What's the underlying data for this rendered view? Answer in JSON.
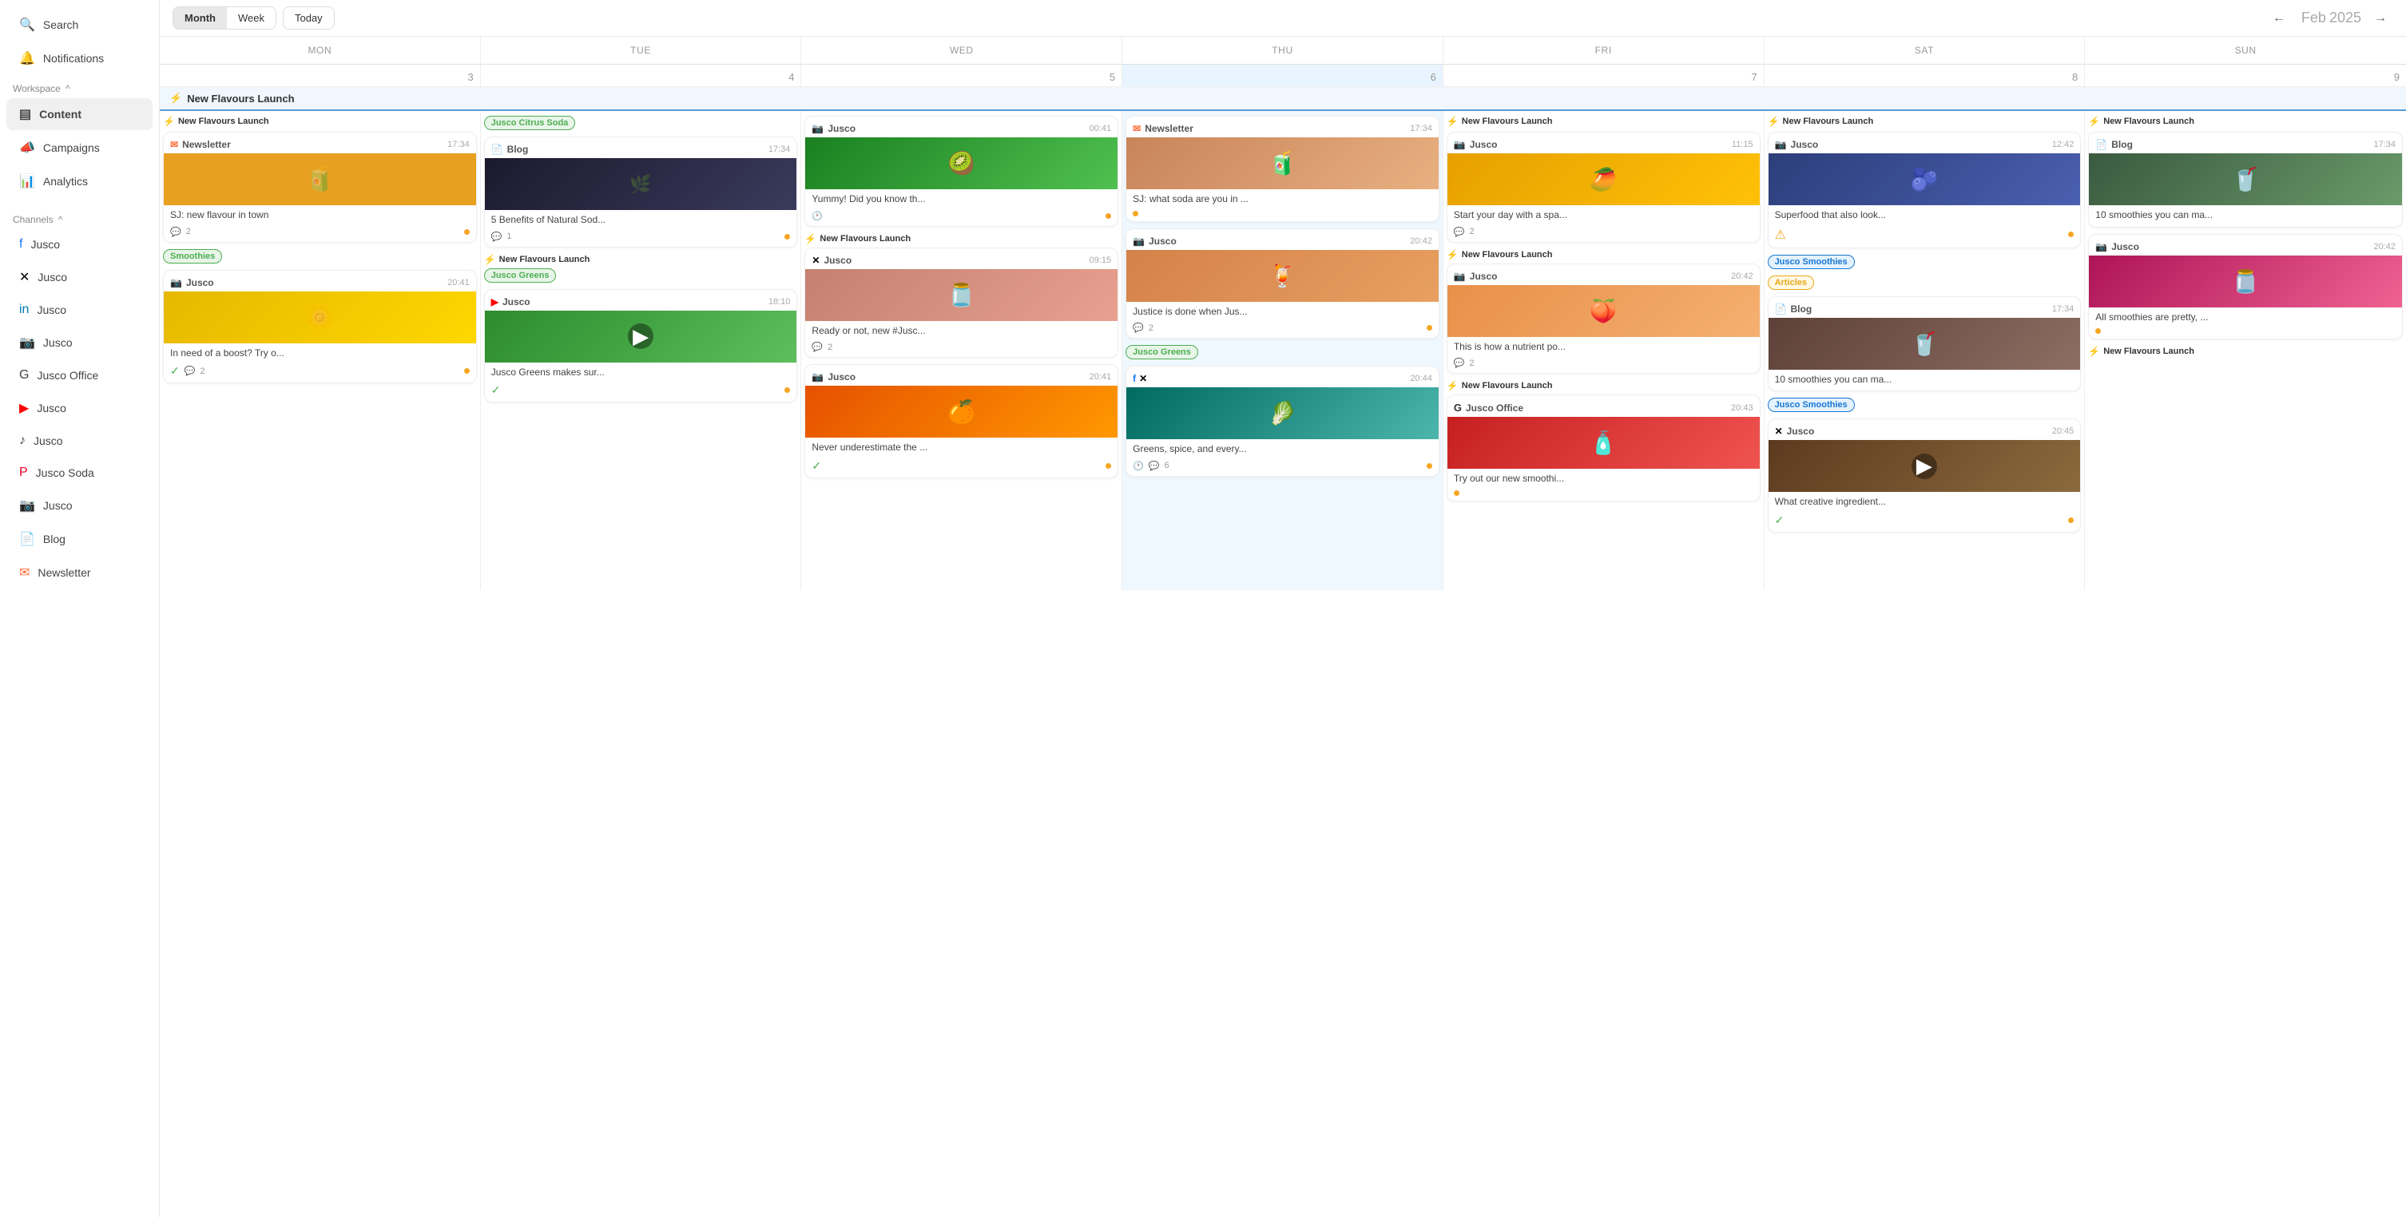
{
  "sidebar": {
    "search_label": "Search",
    "notifications_label": "Notifications",
    "workspace_label": "Workspace",
    "workspace_chevron": "^",
    "content_label": "Content",
    "campaigns_label": "Campaigns",
    "analytics_label": "Analytics",
    "channels_label": "Channels",
    "channels_chevron": "^",
    "channels": [
      {
        "label": "Jusco",
        "type": "facebook"
      },
      {
        "label": "Jusco",
        "type": "twitter"
      },
      {
        "label": "Jusco",
        "type": "linkedin"
      },
      {
        "label": "Jusco",
        "type": "instagram"
      },
      {
        "label": "Jusco Office",
        "type": "google"
      },
      {
        "label": "Jusco",
        "type": "youtube"
      },
      {
        "label": "Jusco",
        "type": "tiktok"
      },
      {
        "label": "Jusco Soda",
        "type": "pinterest"
      },
      {
        "label": "Jusco",
        "type": "instagram2"
      },
      {
        "label": "Blog",
        "type": "blog"
      },
      {
        "label": "Newsletter",
        "type": "newsletter"
      }
    ]
  },
  "topbar": {
    "month_label": "Month",
    "week_label": "Week",
    "today_label": "Today",
    "month_name": "Feb",
    "year": "2025"
  },
  "calendar": {
    "days": [
      "MON",
      "TUE",
      "WED",
      "THU",
      "FRI",
      "SAT",
      "SUN"
    ],
    "dates": [
      "3",
      "4",
      "5",
      "6",
      "7",
      "8",
      "9"
    ],
    "campaign_name": "New Flavours Launch",
    "columns": {
      "mon": {
        "date": "3",
        "campaign": "New Flavours Launch",
        "cards": [
          {
            "platform": "Newsletter",
            "time": "17:34",
            "img_type": "orange",
            "text": "SJ: new flavour in town",
            "comments": "2",
            "dot": "orange"
          }
        ],
        "cards2": [
          {
            "tag": "Smoothies",
            "tag_type": "green",
            "platform": "Instagram",
            "time": "20:41",
            "img_type": "yellow",
            "text": "In need of a boost? Try o...",
            "check": true,
            "comments": "2",
            "dot": "orange"
          }
        ]
      },
      "tue": {
        "date": "4",
        "cards": [
          {
            "tag": "Jusco Citrus Soda",
            "tag_type": "green",
            "platform": "Blog",
            "time": "17:34",
            "img_type": "dark",
            "text": "5 Benefits of Natural Sod...",
            "comments": "1",
            "dot": "orange"
          },
          {
            "campaign": "New Flavours Launch",
            "tag": "Jusco Greens",
            "tag_type": "green",
            "platform": "YouTube",
            "time": "18:10",
            "img_type": "green",
            "text": "Jusco Greens makes sur...",
            "check": true,
            "dot": "orange",
            "video": true
          }
        ]
      },
      "wed": {
        "date": "5",
        "cards": [
          {
            "platform": "Instagram",
            "time": "00:41",
            "img_type": "green2",
            "text": "Yummy! Did you know th...",
            "dot": "orange"
          },
          {
            "campaign": "New Flavours Launch",
            "platform": "Twitter",
            "time": "09:15",
            "img_type": "peach",
            "text": "Ready or not, new #Jusc...",
            "comments": "2"
          },
          {
            "platform": "Instagram",
            "time": "20:41",
            "img_type": "citrus",
            "text": "Never underestimate the ...",
            "check": true,
            "dot": "orange"
          }
        ]
      },
      "thu": {
        "date": "6",
        "cards": [
          {
            "platform": "Newsletter",
            "time": "17:34",
            "img_type": "peach2",
            "text": "SJ: what soda are you in ...",
            "dot": "orange"
          },
          {
            "platform": "Instagram",
            "time": "20:42",
            "img_type": "orange2",
            "text": "Justice is done when Jus...",
            "comments": "2",
            "dot": "orange"
          },
          {
            "tag": "Jusco Greens",
            "tag_type": "green",
            "platform_multi": [
              "facebook",
              "twitter"
            ],
            "time": "20:44",
            "img_type": "teal",
            "text": "Greens, spice, and every...",
            "dot_clock": true,
            "comments": "6",
            "dot": "orange"
          }
        ]
      },
      "fri": {
        "date": "7",
        "campaign": "New Flavours Launch",
        "cards": [
          {
            "platform": "Instagram",
            "time": "11:15",
            "img_type": "mango",
            "text": "Start your day with a spa...",
            "comments": "2"
          },
          {
            "campaign": "New Flavours Launch",
            "platform": "Instagram",
            "time": "20:42",
            "img_type": "peach3",
            "text": "This is how a nutrient po...",
            "comments": "2"
          },
          {
            "campaign": "New Flavours Launch",
            "platform": "Jusco Office",
            "time": "20:43",
            "img_type": "red",
            "text": "Try out our new smoothi...",
            "dot": "orange"
          }
        ]
      },
      "sat": {
        "date": "8",
        "campaign": "New Flavours Launch",
        "cards": [
          {
            "platform": "Instagram",
            "time": "12:42",
            "img_type": "blueberry",
            "text": "Superfood that also look...",
            "dot": "orange"
          },
          {
            "tag": "Jusco Smoothies",
            "tag_type": "blue",
            "tag2": "Articles",
            "tag2_type": "yellow",
            "platform": "Blog",
            "time": "17:34",
            "img_type": "smoothie",
            "text": "10 smoothies you can ma..."
          },
          {
            "platform": "Instagram",
            "time": "20:45",
            "img_type": "smoothie2",
            "text": "What creative ingredient...",
            "check": true,
            "dot": "orange",
            "video": true
          },
          {
            "platform": "Instagram",
            "time": "20:42",
            "img_type": "purple-pink",
            "text": "All smoothies are pretty, ...",
            "dot": "orange"
          }
        ]
      }
    }
  }
}
